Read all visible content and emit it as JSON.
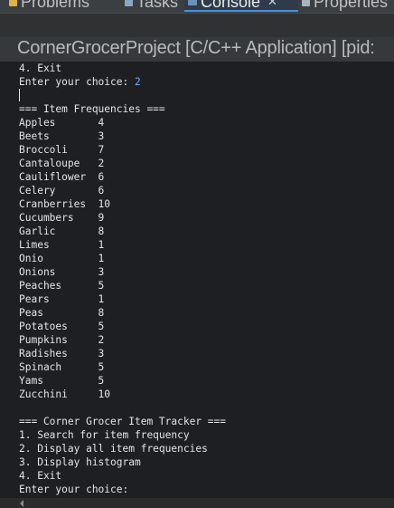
{
  "tabs": [
    {
      "label": "Problems"
    },
    {
      "label": "Tasks"
    },
    {
      "label": "Console",
      "active": true
    },
    {
      "label": "Properties"
    }
  ],
  "console": {
    "title": "CornerGrocerProject [C/C++ Application]  [pid:",
    "lines": [
      {
        "text": "4. Exit"
      },
      {
        "text": "Enter your choice: ",
        "input": "2"
      },
      {
        "text": ""
      },
      {
        "text": "=== Item Frequencies ==="
      },
      {
        "text": "Apples       4"
      },
      {
        "text": "Beets        3"
      },
      {
        "text": "Broccoli     7"
      },
      {
        "text": "Cantaloupe   2"
      },
      {
        "text": "Cauliflower  6"
      },
      {
        "text": "Celery       6"
      },
      {
        "text": "Cranberries  10"
      },
      {
        "text": "Cucumbers    9"
      },
      {
        "text": "Garlic       8"
      },
      {
        "text": "Limes        1"
      },
      {
        "text": "Onio         1"
      },
      {
        "text": "Onions       3"
      },
      {
        "text": "Peaches      5"
      },
      {
        "text": "Pears        1"
      },
      {
        "text": "Peas         8"
      },
      {
        "text": "Potatoes     5"
      },
      {
        "text": "Pumpkins     2"
      },
      {
        "text": "Radishes     3"
      },
      {
        "text": "Spinach      5"
      },
      {
        "text": "Yams         5"
      },
      {
        "text": "Zucchini     10"
      },
      {
        "text": ""
      },
      {
        "text": "=== Corner Grocer Item Tracker ==="
      },
      {
        "text": "1. Search for item frequency"
      },
      {
        "text": "2. Display all item frequencies"
      },
      {
        "text": "3. Display histogram"
      },
      {
        "text": "4. Exit"
      },
      {
        "text": "Enter your choice: "
      }
    ]
  },
  "colors": {
    "console_background": "#1e1f22",
    "output_text": "#e6e6e6",
    "user_input_text": "#6fa8f5",
    "active_tab_underline": "#4a90d9"
  }
}
